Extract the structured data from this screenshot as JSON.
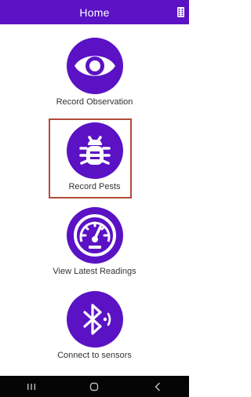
{
  "header": {
    "title": "Home",
    "menu_icon": "dot-grid-menu-icon"
  },
  "tiles": [
    {
      "label": "Record Observation",
      "icon": "eye-icon"
    },
    {
      "label": "Record Pests",
      "icon": "bug-icon",
      "selected": true
    },
    {
      "label": "View Latest Readings",
      "icon": "gauge-icon"
    },
    {
      "label": "Connect to sensors",
      "icon": "bluetooth-icon"
    }
  ],
  "nav_bar": {
    "buttons": [
      "recent-apps-icon",
      "home-icon",
      "back-icon"
    ]
  },
  "colors": {
    "accent": "#5a12c4",
    "selection_border": "#b24a3a",
    "nav_bar": "#050505",
    "label_text": "#333333"
  }
}
